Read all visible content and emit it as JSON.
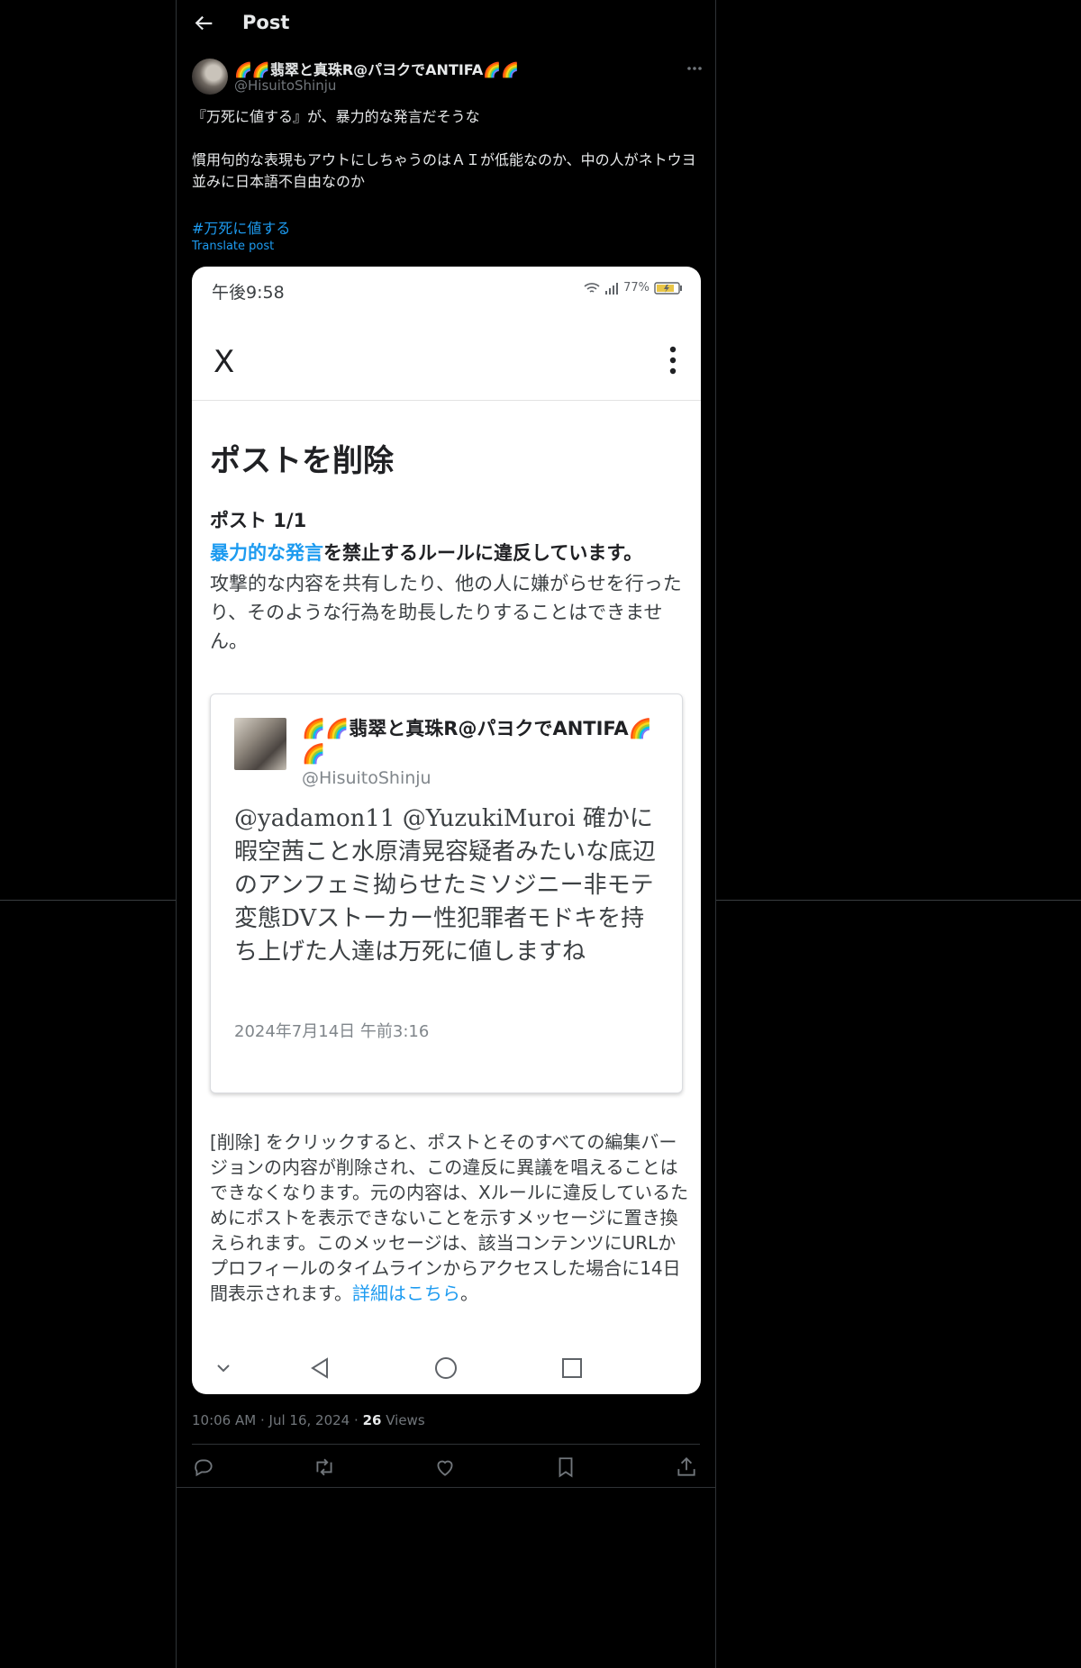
{
  "header": {
    "title": "Post",
    "back_icon": "arrow-left-icon"
  },
  "author": {
    "name": "🌈🌈翡翠と真珠R@パヨクでANTIFA🌈🌈",
    "handle": "@HisuitoShinju"
  },
  "post": {
    "line1": "『万死に値する』が、暴力的な発言だそうな",
    "line2": "慣用句的な表現もアウトにしちゃうのはＡＩが低能なのか、中の人がネトウヨ並みに日本語不自由なのか",
    "hashtag": "#万死に値する",
    "translate": "Translate post"
  },
  "screenshot": {
    "status_time": "午後9:58",
    "battery_percent": "77%",
    "app_logo": "X",
    "title": "ポストを削除",
    "post_count": "ポスト 1/1",
    "rule_link": "暴力的な発言",
    "rule_rest": "を禁止するルールに違反しています。",
    "rule_desc": "攻撃的な内容を共有したり、他の人に嫌がらせを行ったり、そのような行為を助長したりすることはできません。",
    "card": {
      "name": "🌈🌈翡翠と真珠R@パヨクでANTIFA🌈🌈",
      "handle": "@HisuitoShinju",
      "body": "@yadamon11 @YuzukiMuroi 確かに暇空茜こと水原清晃容疑者みたいな底辺のアンフェミ拗らせたミソジニー非モテ変態DVストーカー性犯罪者モドキを持ち上げた人達は万死に値しますね",
      "date": "2024年7月14日 午前3:16"
    },
    "notice_text": "[削除] をクリックすると、ポストとそのすべての編集バージョンの内容が削除され、この違反に異議を唱えることはできなくなります。元の内容は、Xルールに違反しているためにポストを表示できないことを示すメッセージに置き換えられます。このメッセージは、該当コンテンツにURLかプロフィールのタイムラインからアクセスした場合に14日間表示されます。",
    "notice_link": "詳細はこちら",
    "notice_end": "。"
  },
  "meta": {
    "time": "10:06 AM",
    "sep1": "·",
    "date": "Jul 16, 2024",
    "sep2": "·",
    "views_count": "26",
    "views_label": "Views"
  },
  "actions": [
    "reply-icon",
    "repost-icon",
    "like-icon",
    "bookmark-icon",
    "share-icon"
  ]
}
